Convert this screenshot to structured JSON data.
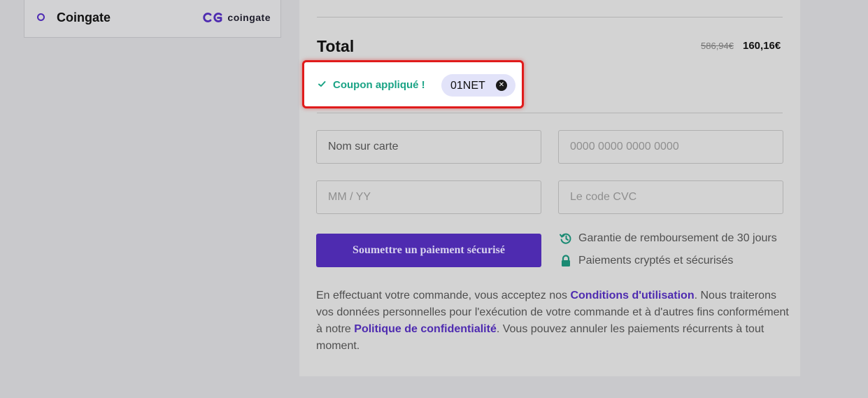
{
  "payment_option": {
    "label": "Coingate",
    "logo_text": "coingate"
  },
  "summary": {
    "total_label": "Total",
    "old_price": "586,94€",
    "new_price": "160,16€"
  },
  "coupon": {
    "status": "Coupon appliqué !",
    "code": "01NET",
    "remove_icon": "close-circle-icon"
  },
  "form": {
    "name_placeholder": "Nom sur carte",
    "card_placeholder": "0000 0000 0000 0000",
    "expiry_placeholder": "MM / YY",
    "cvc_placeholder": "Le code CVC",
    "submit_label": "Soumettre un paiement sécurisé"
  },
  "features": [
    {
      "icon": "history-icon",
      "text": "Garantie de remboursement de 30 jours"
    },
    {
      "icon": "lock-icon",
      "text": "Paiements cryptés et sécurisés"
    }
  ],
  "legal": {
    "part1": "En effectuant votre commande, vous acceptez nos ",
    "terms_link": "Conditions d'utilisation",
    "part2": ". Nous traiterons vos données personnelles pour l'exécution de votre commande et à d'autres fins conformément à notre ",
    "privacy_link": "Politique de confidentialité",
    "part3": ". Vous pouvez annuler les paiements récurrents à tout moment."
  },
  "colors": {
    "accent": "#4e2bb0",
    "success": "#1aa385",
    "highlight_border": "#e01b1b",
    "chip_bg": "#e2e3f9",
    "feature_icon": "#1a8a73"
  }
}
